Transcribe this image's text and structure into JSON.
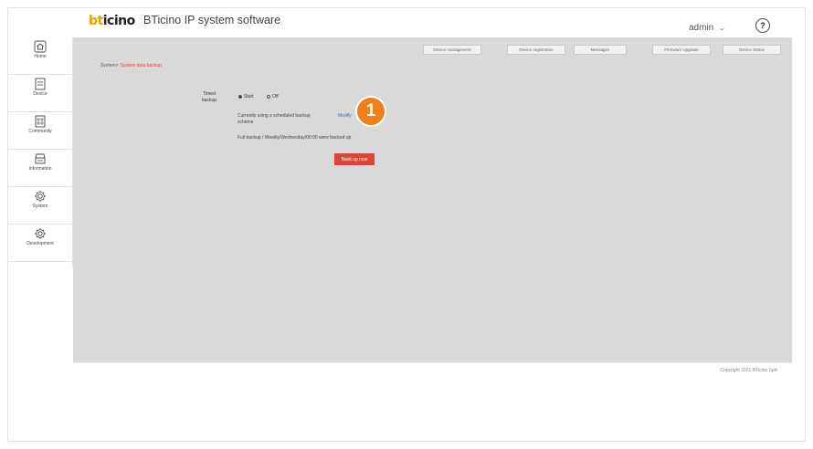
{
  "header": {
    "logo_b": "bt",
    "logo_rest": "icino",
    "app_title": "BTicino IP system software",
    "user": "admin",
    "help_symbol": "?"
  },
  "sidebar": {
    "items": [
      {
        "label": "Home",
        "icon": "home-icon"
      },
      {
        "label": "Device",
        "icon": "device-icon"
      },
      {
        "label": "Community",
        "icon": "community-icon"
      },
      {
        "label": "Information",
        "icon": "information-icon"
      },
      {
        "label": "System",
        "icon": "gear-icon"
      },
      {
        "label": "Development",
        "icon": "gear-icon"
      }
    ]
  },
  "toolbar": {
    "buttons": [
      "Device management",
      "Device registration",
      "Messages",
      "Firmware Upgrade",
      "Device Status"
    ]
  },
  "breadcrumb": {
    "root": "System",
    "current": "System data backup"
  },
  "backup": {
    "timed_label": "Timed backup",
    "option_start": "Start",
    "option_off": "Off",
    "schedule_line1": "Currently using a scheduled backup",
    "schedule_line2": "scheme",
    "modify_link": "Modify",
    "full_backup": "Full backup / Weekly/Wednesday/00:00 were backed up",
    "backup_now": "Back up now"
  },
  "callout": {
    "number": "1",
    "color": "#ef7f1a"
  },
  "footer": {
    "copyright": "Copyright 2021 BTicino SpA"
  },
  "colors": {
    "accent_red": "#d8473a",
    "link_blue": "#3b6fd1",
    "brand_orange": "#f2a000"
  }
}
